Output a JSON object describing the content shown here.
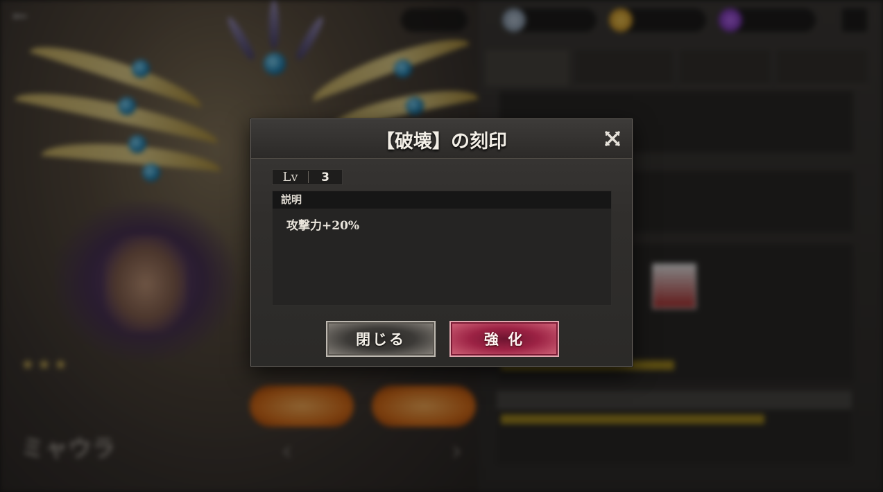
{
  "modal": {
    "title": "【破壊】の刻印",
    "level_label": "Lv",
    "level_value": "3",
    "description_header": "説明",
    "description_text": "攻撃力+20%",
    "close_button_label": "閉じる",
    "enhance_button_label": "強 化",
    "close_icon": "close-icon"
  },
  "background": {
    "character_name": "ミャウラ",
    "back_icon": "back-arrow-icon"
  },
  "colors": {
    "enhance_button": "#9c2244",
    "close_button": "#3c3a37",
    "modal_bg": "#302e2c",
    "description_header_bg": "#161616"
  }
}
